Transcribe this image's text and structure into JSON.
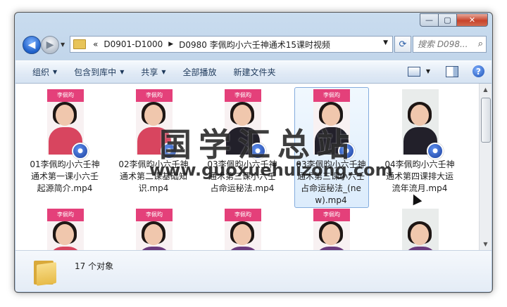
{
  "window": {
    "caption": {
      "minimize": "—",
      "maximize": "▢",
      "close": "✕"
    }
  },
  "nav": {
    "back_glyph": "◀",
    "forward_glyph": "▶",
    "overflow": "«",
    "breadcrumbs": [
      "D0901-D1000",
      "D0980 李佩昀小六壬神通术15课时视频"
    ],
    "separator": "▶",
    "dropdown": "▼",
    "refresh_glyph": "⟳",
    "search_placeholder": "搜索 D098...",
    "search_glyph": "⌕"
  },
  "toolbar": {
    "organize": "组织",
    "include": "包含到库中",
    "share": "共享",
    "play_all": "全部播放",
    "new_folder": "新建文件夹",
    "caret": "▼",
    "help": "?"
  },
  "files": [
    {
      "name": "01李佩昀小六壬神通术第一课小六壬起源简介.mp4",
      "band": "李佩昀"
    },
    {
      "name": "02李佩昀小六壬神通术第二课基础知识.mp4",
      "band": "李佩昀"
    },
    {
      "name": "03李佩昀小六壬神通术第三课小六壬占命运秘法.mp4",
      "band": "李佩昀"
    },
    {
      "name": "03李佩昀小六壬神通术第三课小六壬占命运秘法_(new).mp4",
      "band": "李佩昀"
    },
    {
      "name": "04李佩昀小六壬神通术第四课排大运流年流月.mp4",
      "band": ""
    }
  ],
  "row2_bands": [
    "李佩昀",
    "李佩昀",
    "李佩昀",
    "李佩昀",
    ""
  ],
  "status": {
    "count_text": "17 个对象"
  },
  "watermark": {
    "title": "国学汇总站",
    "url": "www.guoxuehuizong.com"
  },
  "colors": {
    "accent": "#1e5fc8",
    "thumb_band": "#e4407a"
  }
}
